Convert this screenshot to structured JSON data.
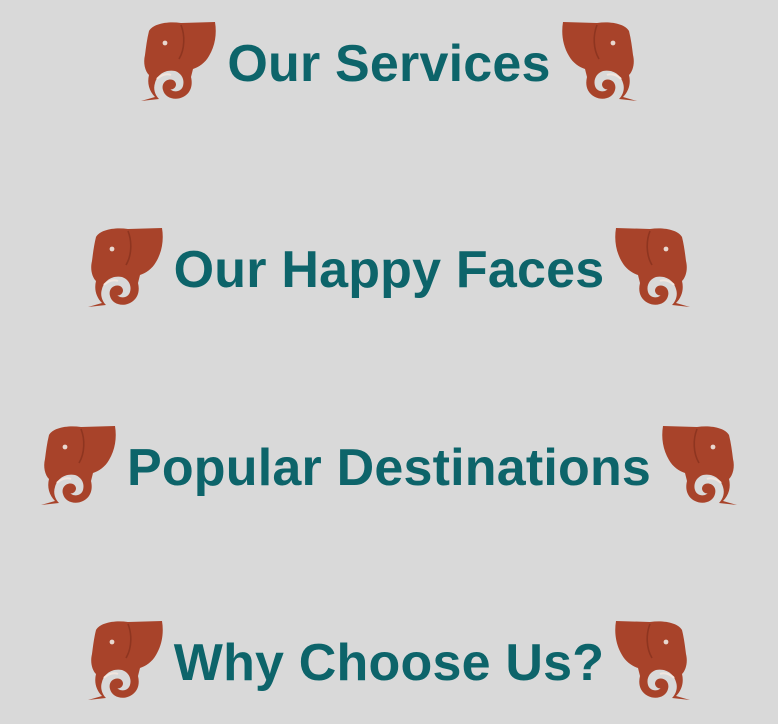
{
  "theme": {
    "background": "#d9d9d9",
    "heading_color": "#0d646a",
    "ornament_color": "#a8432a"
  },
  "ornament_icon": "elephant-icon",
  "sections": [
    {
      "title": "Our Services"
    },
    {
      "title": "Our Happy Faces"
    },
    {
      "title": "Popular Destinations"
    },
    {
      "title": "Why Choose Us?"
    }
  ]
}
